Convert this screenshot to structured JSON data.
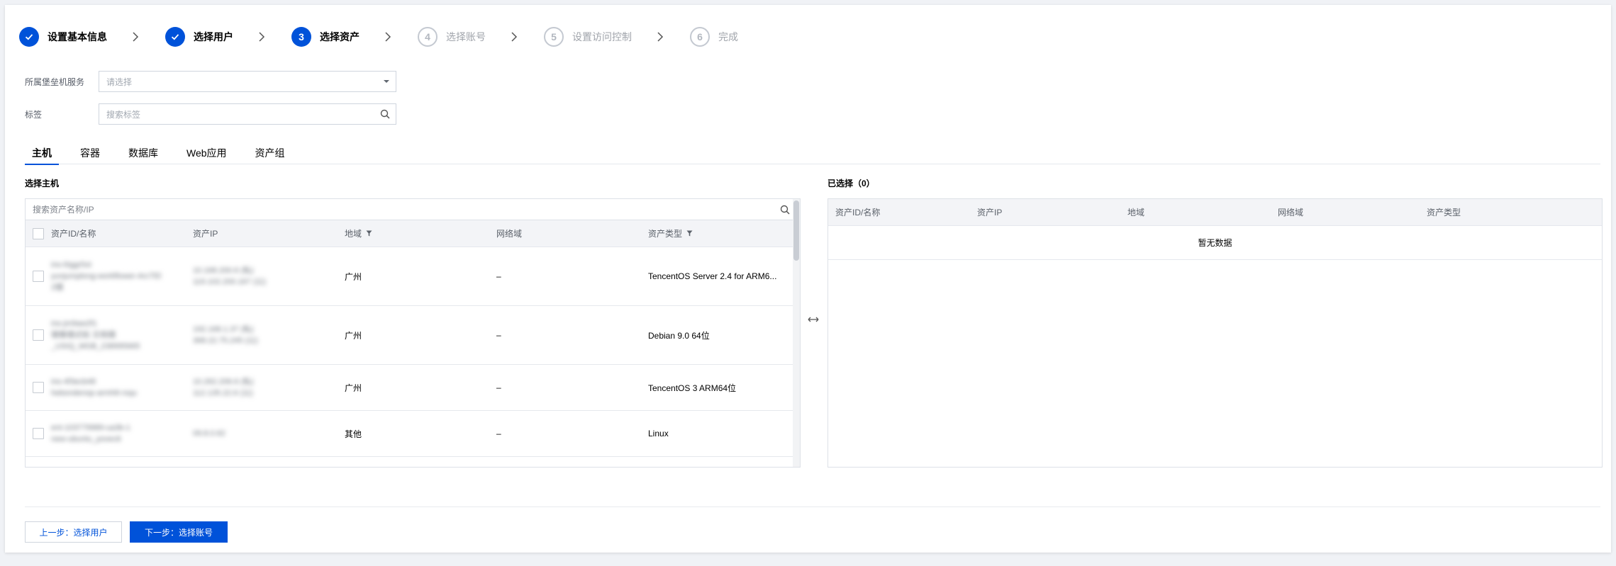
{
  "steps": [
    {
      "label": "设置基本信息",
      "state": "done"
    },
    {
      "label": "选择用户",
      "state": "done"
    },
    {
      "label": "选择资产",
      "state": "active",
      "number": "3"
    },
    {
      "label": "选择账号",
      "state": "pending",
      "number": "4"
    },
    {
      "label": "设置访问控制",
      "state": "pending",
      "number": "5"
    },
    {
      "label": "完成",
      "state": "pending",
      "number": "6"
    }
  ],
  "form": {
    "bastion_label": "所属堡垒机服务",
    "bastion_placeholder": "请选择",
    "tag_label": "标签",
    "tag_placeholder": "搜索标签"
  },
  "tabs": [
    "主机",
    "容器",
    "数据库",
    "Web应用",
    "资产组"
  ],
  "left": {
    "title": "选择主机",
    "search_placeholder": "搜索资产名称/IP",
    "columns": [
      "资产ID/名称",
      "资产IP",
      "地域",
      "网络域",
      "资产类型"
    ],
    "rows": [
      {
        "name_lines": [
          "ins-l0ggr5xt",
          "yunjumplong-workflower-ArcTEl",
          "2镜"
        ],
        "ip_lines": [
          "10.168.200.6 (私)",
          "119.102.200.167 (公)"
        ],
        "region": "广州",
        "net": "–",
        "type": "TencentOS Server 2.4 for ARM6..."
      },
      {
        "name_lines": [
          "ins-jm9aw2f1",
          "镜像镜式标 文档镜",
          "_USIQ_MGB_238995665"
        ],
        "ip_lines": [
          "192.168.1.37 (私)",
          "368.22.75.245 (公)"
        ],
        "region": "广州",
        "net": "–",
        "type": "Debian 9.0 64位"
      },
      {
        "name_lines": [
          "ins-4f3ecb48",
          "hebondenop-armh8-rsqu"
        ],
        "ip_lines": [
          "10.262.206.6 (私)",
          "112.135.22.6 (公)"
        ],
        "region": "广州",
        "net": "–",
        "type": "TencentOS 3 ARM64位"
      },
      {
        "name_lines": [
          "ent-103779989-ua3b-1",
          "new-ubuntu_yovectt"
        ],
        "ip_lines": [
          "09.8.0.62"
        ],
        "region": "其他",
        "net": "–",
        "type": "Linux"
      }
    ]
  },
  "right": {
    "title": "已选择（0）",
    "columns": [
      "资产ID/名称",
      "资产IP",
      "地域",
      "网络域",
      "资产类型"
    ],
    "empty_text": "暂无数据"
  },
  "buttons": {
    "prev": "上一步：选择用户",
    "next": "下一步：选择账号"
  },
  "colors": {
    "primary": "#0052d9"
  }
}
